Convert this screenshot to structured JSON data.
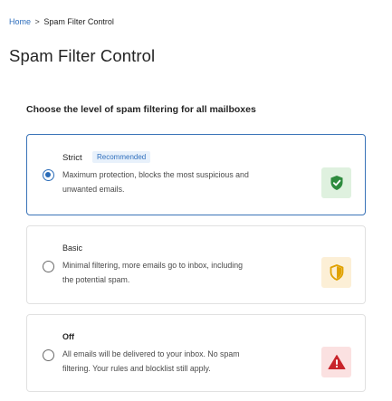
{
  "breadcrumb": {
    "home": "Home",
    "separator": ">",
    "current": "Spam Filter Control"
  },
  "page": {
    "title": "Spam Filter Control",
    "section_heading": "Choose the level of spam filtering for all mailboxes"
  },
  "options": [
    {
      "title": "Strict",
      "badge": "Recommended",
      "description_line1": "Maximum protection, blocks the most suspicious and",
      "description_line2": "unwanted emails.",
      "selected": true,
      "icon": "shield-check-icon",
      "icon_color": "#2e8b3e"
    },
    {
      "title": "Basic",
      "description_line1": "Minimal filtering, more emails go to inbox, including",
      "description_line2": "the potential spam.",
      "selected": false,
      "icon": "shield-half-icon",
      "icon_color": "#e0a100"
    },
    {
      "title": "Off",
      "description_line1": "All emails will be delivered to your inbox. No spam",
      "description_line2": "filtering. Your rules and blocklist still apply.",
      "selected": false,
      "icon": "warning-triangle-icon",
      "icon_color": "#c8242b"
    }
  ],
  "colors": {
    "accent": "#2b6cb8",
    "link": "#2f6fbd"
  }
}
